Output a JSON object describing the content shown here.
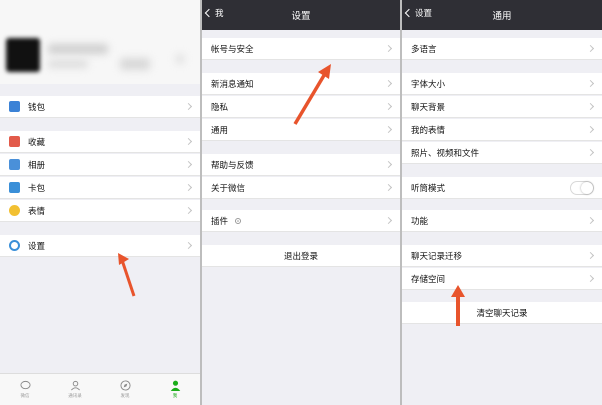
{
  "left_panel": {
    "wallet": "钱包",
    "favorites": "收藏",
    "album": "相册",
    "card_bag": "卡包",
    "stickers": "表情",
    "settings": "设置",
    "tabbar": [
      {
        "label": "微信"
      },
      {
        "label": "通讯录"
      },
      {
        "label": "发现"
      },
      {
        "label": "我"
      }
    ]
  },
  "middle_panel": {
    "back": "我",
    "title": "设置",
    "account_security": "帐号与安全",
    "new_message_notify": "新消息通知",
    "privacy": "隐私",
    "general": "通用",
    "help_feedback": "帮助与反馈",
    "about_wechat": "关于微信",
    "plugins": "插件",
    "logout": "退出登录"
  },
  "right_panel": {
    "back": "设置",
    "title": "通用",
    "language": "多语言",
    "font_size": "字体大小",
    "chat_background": "聊天背景",
    "my_stickers": "我的表情",
    "photos_videos_files": "照片、视频和文件",
    "earpiece_mode": "听筒模式",
    "earpiece_mode_enabled": false,
    "features": "功能",
    "chat_history_migration": "聊天记录迁移",
    "storage": "存储空间",
    "clear_chat_history": "清空聊天记录"
  },
  "colors": {
    "navbar": "#2f2f35",
    "annotation_arrow": "#e8542c",
    "accent_green": "#1aad19",
    "background": "#efeff4"
  }
}
